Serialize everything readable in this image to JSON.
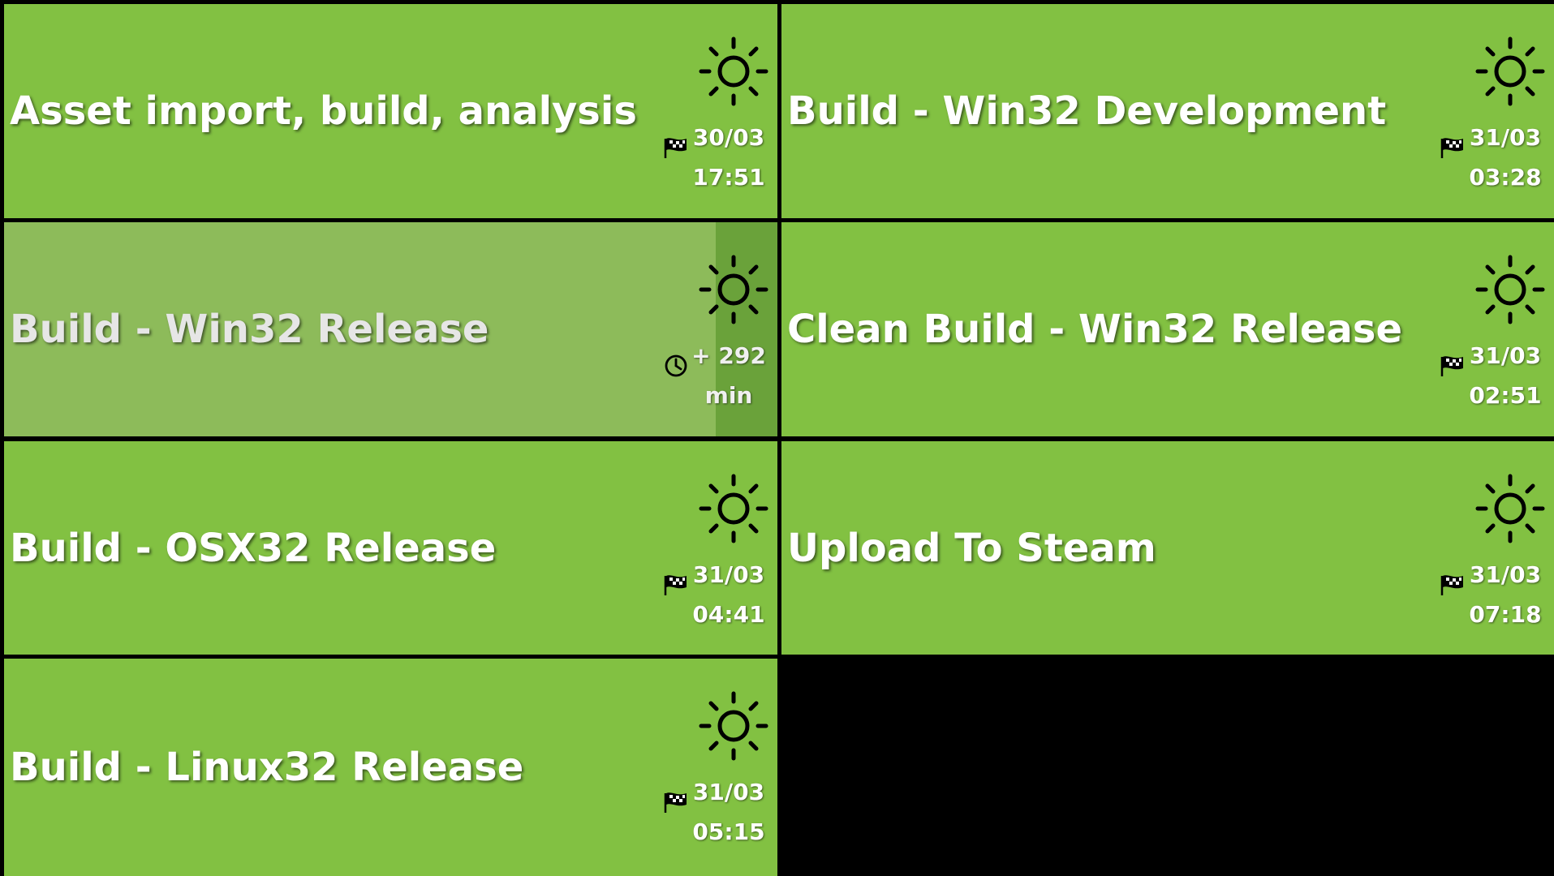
{
  "tiles": [
    {
      "title": "Asset import, build, analysis",
      "status": "finished",
      "status_icon": "finish-flag-icon",
      "weather_icon": "sun-icon",
      "line1": "30/03",
      "line2": "17:51"
    },
    {
      "title": "Build - Win32 Development",
      "status": "finished",
      "status_icon": "finish-flag-icon",
      "weather_icon": "sun-icon",
      "line1": "31/03",
      "line2": "03:28"
    },
    {
      "title": "Build - Win32 Release",
      "status": "running",
      "status_icon": "clock-icon",
      "weather_icon": "sun-icon",
      "line1": "+ 292",
      "line2": "min",
      "progress_percent": 92
    },
    {
      "title": "Clean Build - Win32 Release",
      "status": "finished",
      "status_icon": "finish-flag-icon",
      "weather_icon": "sun-icon",
      "line1": "31/03",
      "line2": "02:51"
    },
    {
      "title": "Build - OSX32 Release",
      "status": "finished",
      "status_icon": "finish-flag-icon",
      "weather_icon": "sun-icon",
      "line1": "31/03",
      "line2": "04:41"
    },
    {
      "title": "Upload To Steam",
      "status": "finished",
      "status_icon": "finish-flag-icon",
      "weather_icon": "sun-icon",
      "line1": "31/03",
      "line2": "07:18"
    },
    {
      "title": "Build - Linux32 Release",
      "status": "finished",
      "status_icon": "finish-flag-icon",
      "weather_icon": "sun-icon",
      "line1": "31/03",
      "line2": "05:15"
    }
  ],
  "colors": {
    "success": "#82c142",
    "running_fill": "#8dbb5a",
    "running_remaining": "#6aa23a",
    "background": "#000000"
  }
}
